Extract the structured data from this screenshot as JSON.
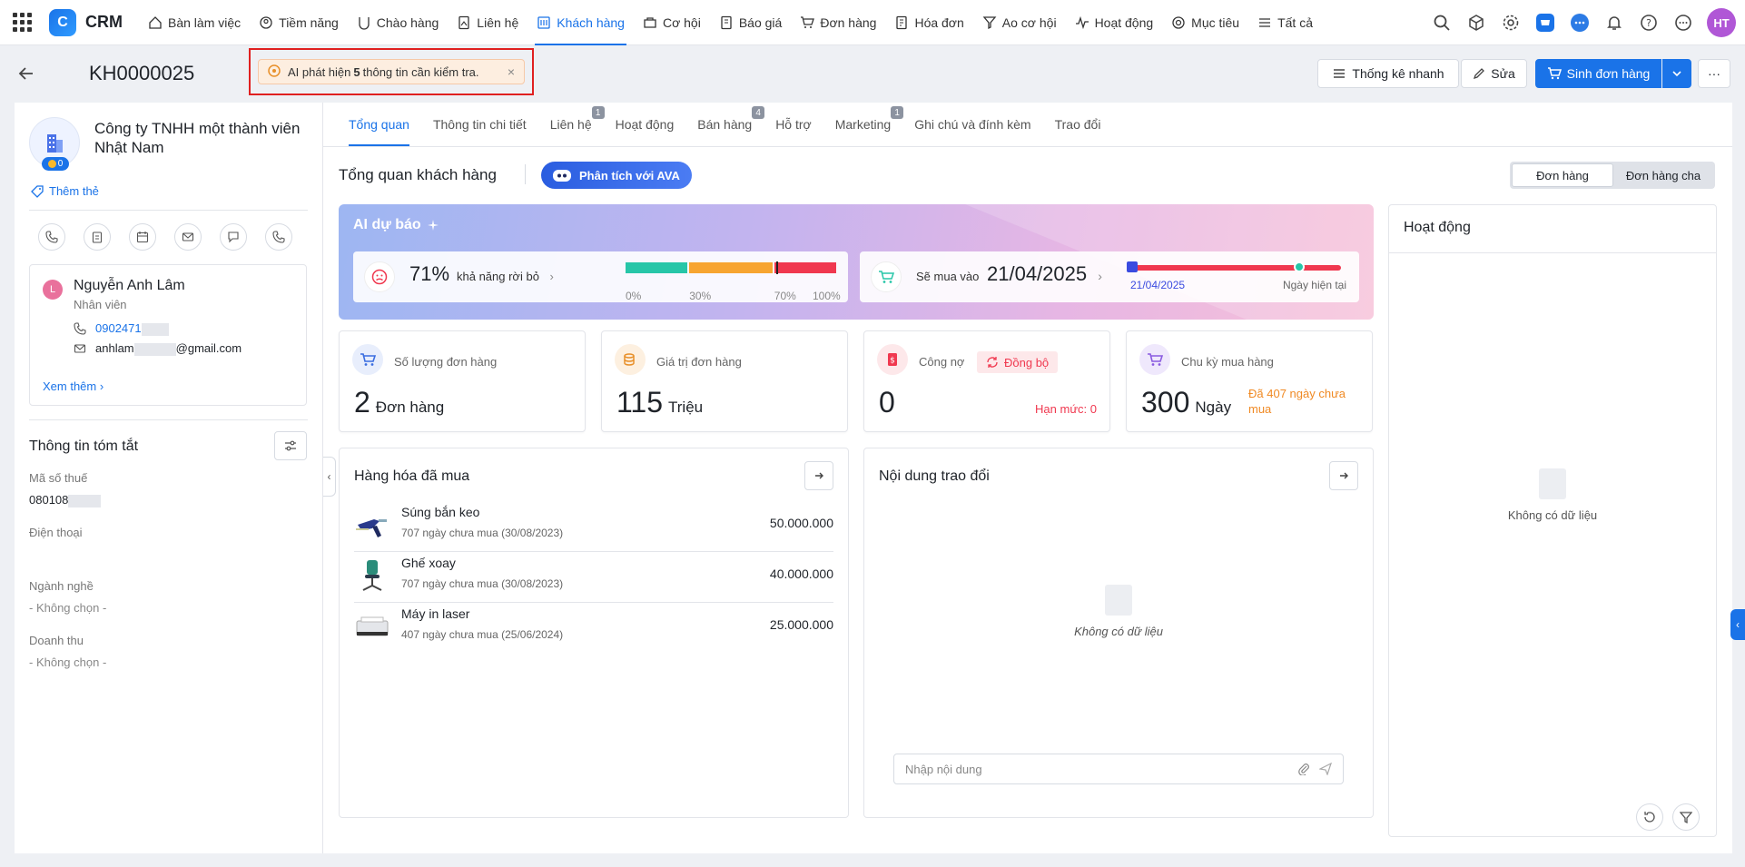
{
  "topnav": {
    "app_name": "CRM",
    "logo_letter": "C",
    "items": [
      {
        "label": "Bàn làm việc",
        "icon": "home-icon"
      },
      {
        "label": "Tiềm năng",
        "icon": "prospect-icon"
      },
      {
        "label": "Chào hàng",
        "icon": "offer-icon"
      },
      {
        "label": "Liên hệ",
        "icon": "contact-icon"
      },
      {
        "label": "Khách hàng",
        "icon": "customer-icon",
        "active": true
      },
      {
        "label": "Cơ hội",
        "icon": "opportunity-icon"
      },
      {
        "label": "Báo giá",
        "icon": "quote-icon"
      },
      {
        "label": "Đơn hàng",
        "icon": "cart-icon"
      },
      {
        "label": "Hóa đơn",
        "icon": "invoice-icon"
      },
      {
        "label": "Ao cơ hội",
        "icon": "funnel-icon"
      },
      {
        "label": "Hoạt động",
        "icon": "activity-icon"
      },
      {
        "label": "Mục tiêu",
        "icon": "target-icon"
      },
      {
        "label": "Tất cả",
        "icon": "menu-icon"
      }
    ],
    "avatar_initials": "HT"
  },
  "header": {
    "customer_code": "KH0000025",
    "ai_alert": {
      "prefix": "AI phát hiện",
      "count": "5",
      "suffix": "thông tin cần kiểm tra.",
      "close": "×"
    },
    "quick_stats_label": "Thống kê nhanh",
    "edit_label": "Sửa",
    "create_order_label": "Sinh đơn hàng",
    "more_label": "···"
  },
  "left": {
    "company_name": "Công ty TNHH một thành viên Nhật Nam",
    "coin_count": "0",
    "add_tag_label": "Thêm thẻ",
    "contact": {
      "initial": "L",
      "name": "Nguyễn Anh Lâm",
      "role": "Nhân viên",
      "phone": "0902471",
      "email_prefix": "anhlam",
      "email_suffix": "@gmail.com",
      "see_more": "Xem thêm"
    },
    "summary_title": "Thông tin tóm tắt",
    "fields": [
      {
        "label": "Mã số thuế",
        "value": "080108"
      },
      {
        "label": "Điện thoại",
        "value": ""
      },
      {
        "label": "Ngành nghề",
        "value": "- Không chọn -"
      },
      {
        "label": "Doanh thu",
        "value": "- Không chọn -"
      }
    ]
  },
  "tabs": [
    {
      "label": "Tổng quan",
      "active": true,
      "badge": ""
    },
    {
      "label": "Thông tin chi tiết",
      "badge": ""
    },
    {
      "label": "Liên hệ",
      "badge": "1"
    },
    {
      "label": "Hoạt động",
      "badge": ""
    },
    {
      "label": "Bán hàng",
      "badge": "4"
    },
    {
      "label": "Hỗ trợ",
      "badge": ""
    },
    {
      "label": "Marketing",
      "badge": "1"
    },
    {
      "label": "Ghi chú và đính kèm",
      "badge": ""
    },
    {
      "label": "Trao đổi",
      "badge": ""
    }
  ],
  "overview": {
    "title": "Tổng quan khách hàng",
    "ava_button": "Phân tích với AVA",
    "segment": [
      "Đơn hàng",
      "Đơn hàng cha"
    ],
    "ai_forecast": {
      "title": "AI dự báo",
      "churn_percent": "71%",
      "churn_value": 71,
      "churn_label": "khả năng rời bỏ",
      "gauge_ticks": [
        "0%",
        "30%",
        "70%",
        "100%"
      ],
      "colors": {
        "low": "#27c6a8",
        "mid": "#f7a531",
        "high": "#f0384f"
      },
      "buy_label": "Sẽ mua vào",
      "buy_date": "21/04/2025",
      "timeline_start": "21/04/2025",
      "timeline_end": "Ngày hiện tại"
    },
    "kpis": [
      {
        "label": "Số lượng đơn hàng",
        "value": "2",
        "unit": "Đơn hàng",
        "icon": "cart-icon"
      },
      {
        "label": "Giá trị đơn hàng",
        "value": "115",
        "unit": "Triệu",
        "icon": "coins-icon"
      },
      {
        "label": "Công nợ",
        "value": "0",
        "unit": "",
        "icon": "debt-icon",
        "sync_label": "Đồng bộ",
        "limit": "Hạn mức: 0"
      },
      {
        "label": "Chu kỳ mua hàng",
        "value": "300",
        "unit": "Ngày",
        "icon": "cart-cycle-icon",
        "note": "Đã 407 ngày chưa mua"
      }
    ],
    "purchased": {
      "title": "Hàng hóa đã mua",
      "items": [
        {
          "name": "Súng bắn keo",
          "sub": "707 ngày chưa mua (30/08/2023)",
          "value": "50.000.000"
        },
        {
          "name": "Ghế xoay",
          "sub": "707 ngày chưa mua (30/08/2023)",
          "value": "40.000.000"
        },
        {
          "name": "Máy in laser",
          "sub": "407 ngày chưa mua (25/06/2024)",
          "value": "25.000.000"
        }
      ]
    },
    "exchange": {
      "title": "Nội dung trao đổi",
      "empty": "Không có dữ liệu",
      "input_placeholder": "Nhập nội dung"
    },
    "activity": {
      "title": "Hoạt động",
      "empty": "Không có dữ liệu"
    }
  }
}
